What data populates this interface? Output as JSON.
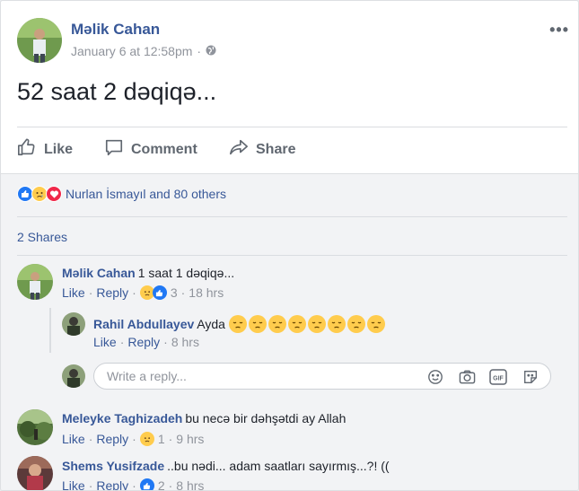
{
  "post": {
    "author": "Məlik Cahan",
    "timestamp": "January 6 at 12:58pm",
    "separator": "·",
    "text": "52 saat 2 dəqiqə...",
    "more": "•••"
  },
  "actions": {
    "like": "Like",
    "comment": "Comment",
    "share": "Share"
  },
  "reactions": {
    "summary": "Nurlan İsmayıl and 80 others",
    "icons": [
      "like",
      "sad",
      "love"
    ]
  },
  "shares": "2 Shares",
  "comments": [
    {
      "author": "Məlik Cahan",
      "text": "1 saat 1 dəqiqə...",
      "like": "Like",
      "reply": "Reply",
      "reaction_count": "3",
      "time": "18 hrs",
      "reply_item": {
        "author": "Rahil Abdullayev",
        "text": "Ayda",
        "emoji_count": 8,
        "like": "Like",
        "reply": "Reply",
        "time": "8 hrs"
      }
    },
    {
      "author": "Meleyke Taghizadeh",
      "text": "bu necə bir dəhşətdi ay Allah",
      "like": "Like",
      "reply": "Reply",
      "reaction_count": "1",
      "time": "9 hrs"
    },
    {
      "author": "Shems Yusifzade",
      "text": "..bu nədi... adam saatları sayırmış...?! ((",
      "like": "Like",
      "reply": "Reply",
      "reaction_count": "2",
      "time": "8 hrs"
    }
  ],
  "reply_box": {
    "placeholder": "Write a reply...",
    "icons": [
      "smiley-icon",
      "camera-icon",
      "gif-icon",
      "sticker-icon"
    ],
    "gif_label": "GIF"
  },
  "colors": {
    "link": "#385898",
    "like_blue": "#2078f4",
    "love_red": "#f0284a",
    "sad_yellow": "#ffcc4d"
  }
}
